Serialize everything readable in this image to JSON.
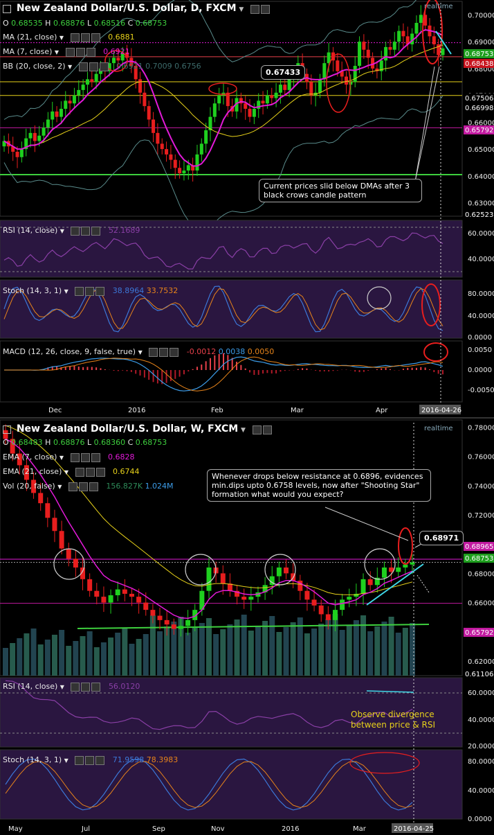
{
  "top": {
    "title": "New Zealand Dollar/U.S. Dollar, D, FXCM",
    "realtime": "realtime",
    "ohlc": {
      "o_label": "O",
      "o": "0.68535",
      "h_label": "H",
      "h": "0.68876",
      "l_label": "L",
      "l": "0.68516",
      "c_label": "C",
      "c": "0.68753"
    },
    "ma21": {
      "label": "MA (21, close)",
      "value": "0.6881"
    },
    "ma7": {
      "label": "MA (7, close)",
      "value": "0.6921"
    },
    "bb": {
      "label": "BB (20, close, 2)",
      "v1": "0.6921",
      "v2": "0.7009",
      "v3": "0.6756"
    },
    "price_axis": [
      "0.70000",
      "0.69000",
      "0.68000",
      "0.67000",
      "0.66000",
      "0.65000",
      "0.64000",
      "0.63000"
    ],
    "price_tags": [
      {
        "text": "0.68753",
        "color": "#1e9e1e"
      },
      {
        "text": "0.68438",
        "color": "#c8141e"
      },
      {
        "text": "0.67506",
        "color": "#000000"
      },
      {
        "text": "0.66998",
        "color": "#000000"
      },
      {
        "text": "0.65792",
        "color": "#c21aa0"
      },
      {
        "text": "0.62523",
        "color": "#000000"
      }
    ],
    "callout_price": "0.67433",
    "annotation": "Current prices slid below DMAs after 3 black crows candle pattern",
    "rsi": {
      "label": "RSI (14, close)",
      "value": "52.1689",
      "axis": [
        "60.0000",
        "40.0000"
      ]
    },
    "stoch": {
      "label": "Stoch (14, 3, 1)",
      "v1": "38.8964",
      "v2": "33.7532",
      "axis": [
        "80.0000",
        "40.0000",
        "0.0000"
      ]
    },
    "macd": {
      "label": "MACD (12, 26, close, 9, false, true)",
      "v1": "-0.0012",
      "v2": "0.0038",
      "v3": "0.0050",
      "axis": [
        "0.0050",
        "0.0000",
        "-0.0050"
      ]
    },
    "time_axis": [
      "Dec",
      "2016",
      "Feb",
      "Mar",
      "Apr"
    ],
    "date_marker": "2016-04-26"
  },
  "bottom": {
    "title": "New Zealand Dollar/U.S. Dollar, W, FXCM",
    "realtime": "realtime",
    "ohlc": {
      "o_label": "O",
      "o": "0.68483",
      "h_label": "H",
      "h": "0.68876",
      "l_label": "L",
      "l": "0.68360",
      "c_label": "C",
      "c": "0.68753"
    },
    "ema7": {
      "label": "EMA (7, close)",
      "value": "0.6828"
    },
    "ema21": {
      "label": "EMA (21, close)",
      "value": "0.6744"
    },
    "vol": {
      "label": "Vol (20, false)",
      "v1": "156.827K",
      "v2": "1.024M"
    },
    "price_axis": [
      "0.78000",
      "0.76000",
      "0.74000",
      "0.72000",
      "0.70000",
      "0.68000",
      "0.66000",
      "0.64000",
      "0.62000"
    ],
    "price_tags": [
      {
        "text": "0.68965",
        "color": "#c21aa0"
      },
      {
        "text": "0.68753",
        "color": "#1e9e1e"
      },
      {
        "text": "0.65792",
        "color": "#c21aa0"
      },
      {
        "text": "0.61106",
        "color": "#000000"
      }
    ],
    "callout_price": "0.68971",
    "annotation": "Whenever drops below resistance at 0.6896, evidences min.dips upto 0.6758 levels, now after \"Shooting Star\" formation what would you expect?",
    "rsi": {
      "label": "RSI (14, close)",
      "value": "56.0120",
      "axis": [
        "60.0000",
        "40.0000",
        "20.0000"
      ]
    },
    "rsi_note": "Observe divergence between price & RSI",
    "stoch": {
      "label": "Stoch (14, 3, 1)",
      "v1": "71.9598",
      "v2": "78.3983",
      "axis": [
        "80.0000",
        "40.0000",
        "0.0000"
      ]
    },
    "time_axis": [
      "May",
      "Jul",
      "Sep",
      "Nov",
      "2016",
      "Mar"
    ],
    "date_marker": "2016-04-25"
  },
  "chart_data": [
    {
      "type": "candlestick",
      "title": "New Zealand Dollar/U.S. Dollar, D, FXCM",
      "ylim": [
        0.625,
        0.705
      ],
      "x_ticks": [
        "Dec",
        "2016",
        "Feb",
        "Mar",
        "Apr",
        "2016-04-26"
      ],
      "levels": [
        0.6896,
        0.68438,
        0.67506,
        0.66998,
        0.65792,
        0.6405
      ],
      "closes": [
        0.653,
        0.651,
        0.649,
        0.647,
        0.65,
        0.654,
        0.656,
        0.653,
        0.655,
        0.658,
        0.661,
        0.664,
        0.662,
        0.665,
        0.668,
        0.667,
        0.67,
        0.672,
        0.674,
        0.676,
        0.675,
        0.678,
        0.68,
        0.679,
        0.682,
        0.684,
        0.683,
        0.686,
        0.684,
        0.681,
        0.676,
        0.671,
        0.666,
        0.661,
        0.656,
        0.652,
        0.65,
        0.648,
        0.646,
        0.643,
        0.641,
        0.642,
        0.644,
        0.642,
        0.648,
        0.652,
        0.657,
        0.662,
        0.667,
        0.67,
        0.671,
        0.666,
        0.664,
        0.669,
        0.667,
        0.665,
        0.662,
        0.665,
        0.668,
        0.667,
        0.67,
        0.669,
        0.671,
        0.674,
        0.672,
        0.676,
        0.679,
        0.682,
        0.678,
        0.675,
        0.67,
        0.671,
        0.676,
        0.682,
        0.686,
        0.683,
        0.679,
        0.677,
        0.674,
        0.675,
        0.681,
        0.69,
        0.687,
        0.684,
        0.68,
        0.679,
        0.683,
        0.688,
        0.687,
        0.69,
        0.694,
        0.692,
        0.689,
        0.693,
        0.697,
        0.7,
        0.696,
        0.692,
        0.689,
        0.685,
        0.6875
      ],
      "rsi": 52.1689,
      "stoch": [
        38.8964,
        33.7532
      ],
      "macd": [
        -0.0012,
        0.0038,
        0.005
      ]
    },
    {
      "type": "candlestick",
      "title": "New Zealand Dollar/U.S. Dollar, W, FXCM",
      "ylim": [
        0.61,
        0.785
      ],
      "x_ticks": [
        "May",
        "Jul",
        "Sep",
        "Nov",
        "2016",
        "Mar",
        "2016-04-25"
      ],
      "levels": [
        0.68965,
        0.68753,
        0.65792
      ],
      "closes": [
        0.772,
        0.762,
        0.754,
        0.744,
        0.735,
        0.728,
        0.718,
        0.709,
        0.697,
        0.69,
        0.684,
        0.676,
        0.668,
        0.664,
        0.66,
        0.665,
        0.669,
        0.666,
        0.664,
        0.66,
        0.655,
        0.651,
        0.648,
        0.645,
        0.642,
        0.644,
        0.648,
        0.655,
        0.668,
        0.684,
        0.68,
        0.673,
        0.668,
        0.664,
        0.662,
        0.664,
        0.667,
        0.672,
        0.678,
        0.684,
        0.68,
        0.675,
        0.668,
        0.662,
        0.658,
        0.652,
        0.648,
        0.655,
        0.662,
        0.664,
        0.666,
        0.676,
        0.672,
        0.677,
        0.684,
        0.681,
        0.684,
        0.686,
        0.6875
      ],
      "rsi": 56.012,
      "stoch": [
        71.9598,
        78.3983
      ],
      "ema": [
        0.6828,
        0.6744
      ],
      "volume": [
        "156.827K",
        "1.024M"
      ]
    }
  ],
  "colors": {
    "up": "#1fd01f",
    "down": "#e81e1e",
    "ma_fast": "#e21ad8",
    "ma_slow": "#e8d21a",
    "bb": "#5a8c8c",
    "osc_bg": "#2a1640",
    "rsi": "#8a3fa6"
  }
}
